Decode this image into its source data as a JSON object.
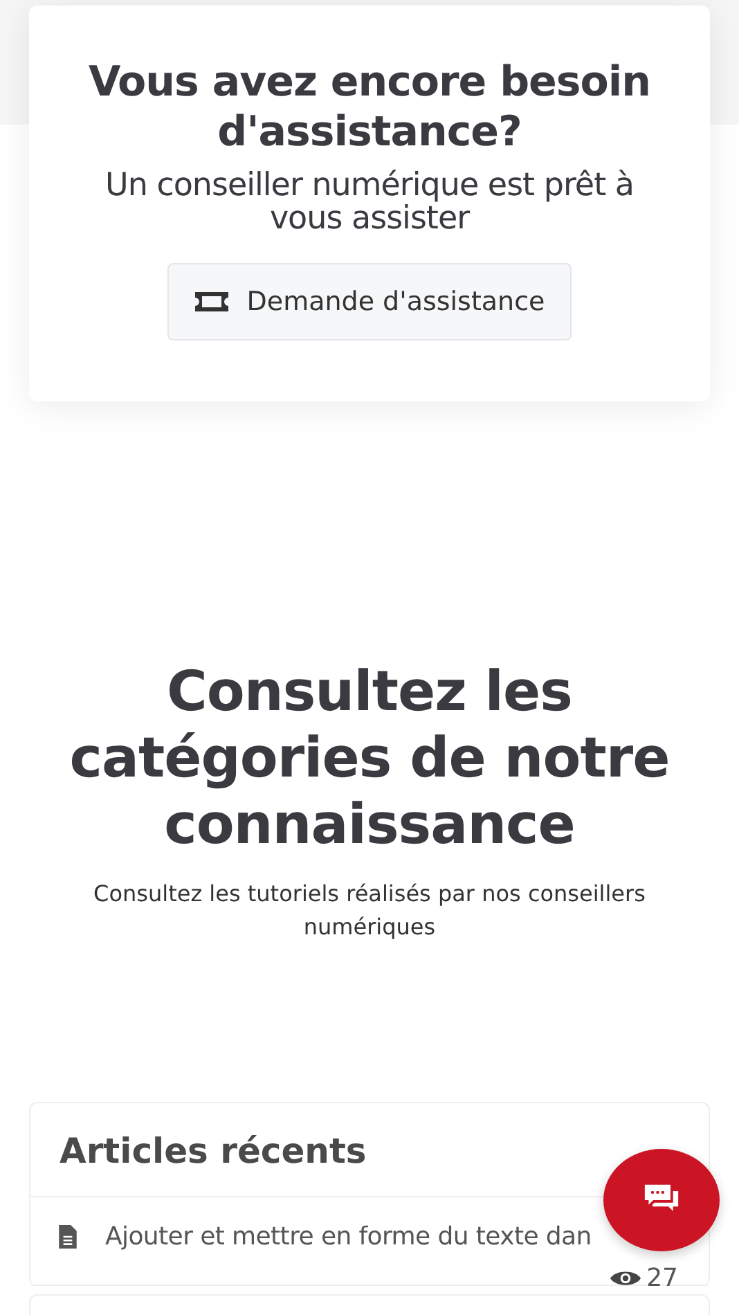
{
  "assistance": {
    "title": "Vous avez encore besoin d'assistance?",
    "subtitle": "Un conseiller numérique est prêt à vous assister",
    "button": "Demande d'assistance"
  },
  "categories": {
    "title": "Consultez les catégories de notre connaissance",
    "subtitle": "Consultez les tutoriels réalisés par nos conseillers numériques"
  },
  "recent": {
    "title": "Articles récents",
    "articles": [
      {
        "title": "Ajouter et mettre en forme du texte dan",
        "views": "27"
      }
    ]
  }
}
